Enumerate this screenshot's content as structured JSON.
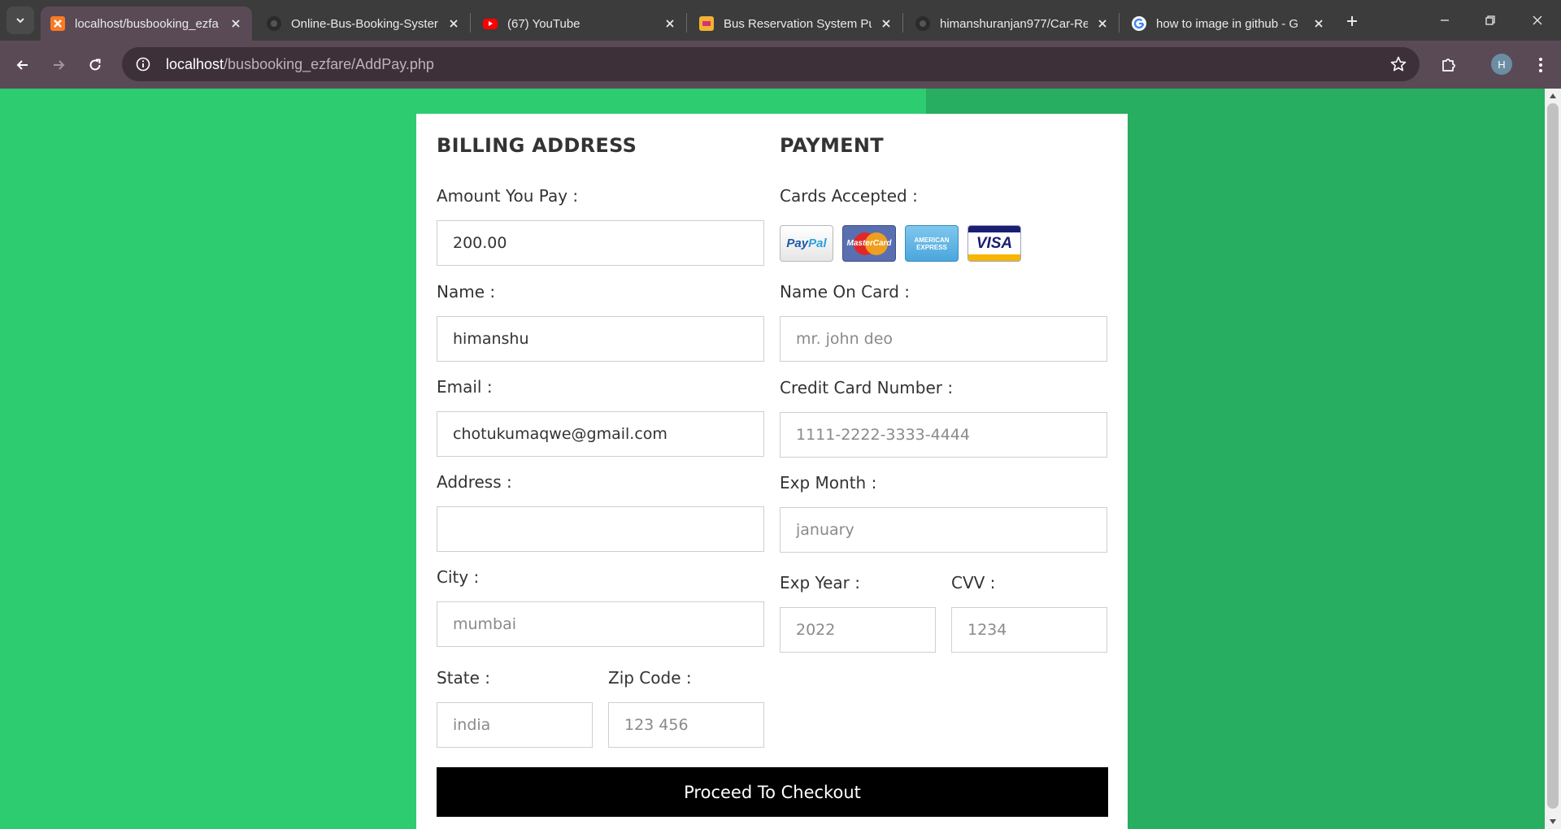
{
  "browser": {
    "tabs": [
      {
        "title": "localhost/busbooking_ezfa",
        "favicon": "xampp-icon",
        "active": true
      },
      {
        "title": "Online-Bus-Booking-Syster",
        "favicon": "github-icon",
        "active": false
      },
      {
        "title": "(67) YouTube",
        "favicon": "youtube-icon",
        "active": false
      },
      {
        "title": "Bus Reservation System Pu",
        "favicon": "project-icon",
        "active": false
      },
      {
        "title": "himanshuranjan977/Car-Re",
        "favicon": "github-icon",
        "active": false
      },
      {
        "title": "how to image in github - G",
        "favicon": "google-icon",
        "active": false
      }
    ],
    "address": {
      "host": "localhost",
      "path": "/busbooking_ezfare/AddPay.php"
    },
    "profile_initial": "H"
  },
  "page": {
    "colors": {
      "bg_left": "#2ecc71",
      "bg_right": "#27ae60",
      "button": "#000000"
    },
    "billing": {
      "heading": "BILLING ADDRESS",
      "amount": {
        "label": "Amount You Pay :",
        "value": "200.00",
        "placeholder": ""
      },
      "name": {
        "label": "Name :",
        "value": "himanshu",
        "placeholder": ""
      },
      "email": {
        "label": "Email :",
        "value": "chotukumaqwe@gmail.com",
        "placeholder": ""
      },
      "address": {
        "label": "Address :",
        "value": "",
        "placeholder": ""
      },
      "city": {
        "label": "City :",
        "value": "",
        "placeholder": "mumbai"
      },
      "state": {
        "label": "State :",
        "value": "",
        "placeholder": "india"
      },
      "zip": {
        "label": "Zip Code :",
        "value": "",
        "placeholder": "123 456"
      }
    },
    "payment": {
      "heading": "PAYMENT",
      "cards_label": "Cards Accepted :",
      "cards": {
        "paypal_a": "Pay",
        "paypal_b": "Pal",
        "mastercard": "MasterCard",
        "amex_1": "AMERICAN",
        "amex_2": "EXPRESS",
        "visa": "VISA"
      },
      "name_on_card": {
        "label": "Name On Card :",
        "value": "",
        "placeholder": "mr. john deo"
      },
      "card_number": {
        "label": "Credit Card Number :",
        "value": "",
        "placeholder": "1111-2222-3333-4444"
      },
      "exp_month": {
        "label": "Exp Month :",
        "value": "",
        "placeholder": "january"
      },
      "exp_year": {
        "label": "Exp Year :",
        "value": "",
        "placeholder": "2022"
      },
      "cvv": {
        "label": "CVV :",
        "value": "",
        "placeholder": "1234"
      }
    },
    "submit_label": "Proceed To Checkout"
  }
}
